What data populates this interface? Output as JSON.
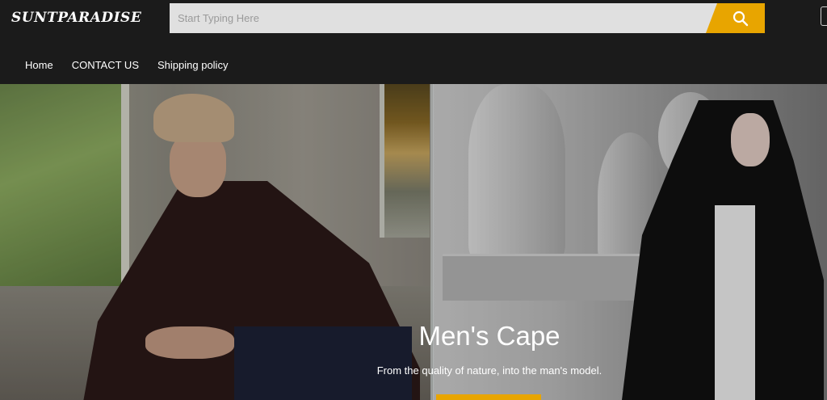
{
  "header": {
    "logo_text": "SUNTPARADISE",
    "search": {
      "placeholder": "Start Typing Here",
      "value": ""
    },
    "search_button_icon": "search-icon",
    "cart_icon": "bag-icon"
  },
  "nav": {
    "items": [
      {
        "label": "Home"
      },
      {
        "label": "CONTACT US"
      },
      {
        "label": "Shipping policy"
      }
    ]
  },
  "hero": {
    "title": "Men's Cape",
    "subtitle": "From the quality of nature, into the man's model."
  },
  "colors": {
    "header_bg": "#1b1b1b",
    "accent": "#e8a500",
    "search_bg": "#e0e0e0"
  }
}
